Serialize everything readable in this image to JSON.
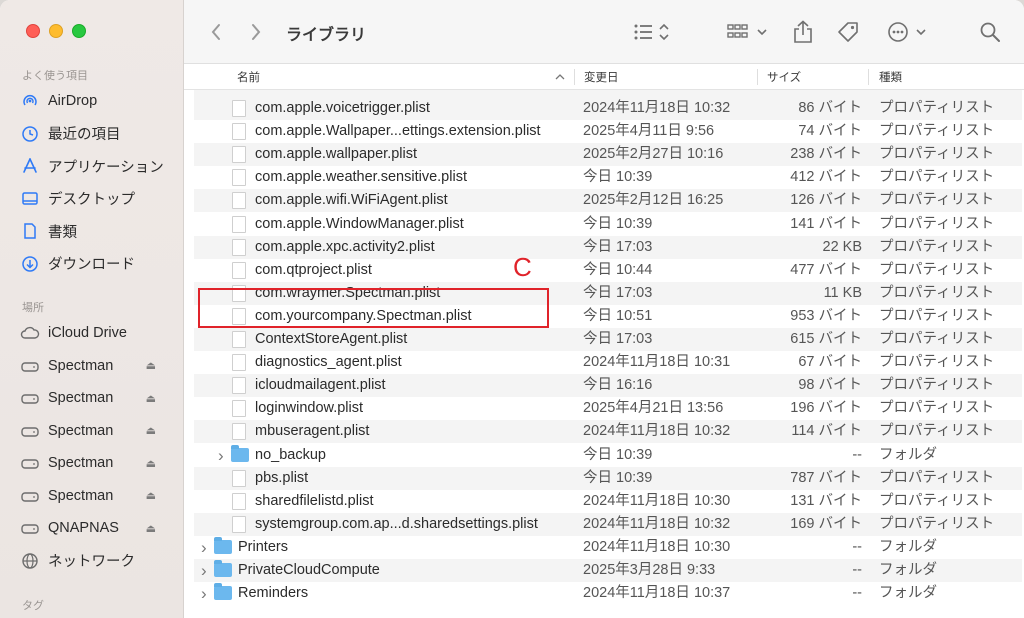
{
  "toolbar": {
    "title": "ライブラリ",
    "back_icon": "chevron-left-icon",
    "forward_icon": "chevron-right-icon"
  },
  "sidebar": {
    "favorites_title": "よく使う項目",
    "locations_title": "場所",
    "tags_title": "タグ",
    "favorites": [
      {
        "label": "AirDrop",
        "icon": "airdrop-icon"
      },
      {
        "label": "最近の項目",
        "icon": "clock-icon"
      },
      {
        "label": "アプリケーション",
        "icon": "applications-icon"
      },
      {
        "label": "デスクトップ",
        "icon": "desktop-icon"
      },
      {
        "label": "書類",
        "icon": "document-icon"
      },
      {
        "label": "ダウンロード",
        "icon": "download-icon"
      }
    ],
    "locations": [
      {
        "label": "iCloud Drive",
        "icon": "cloud-icon",
        "eject": false
      },
      {
        "label": "Spectman",
        "icon": "drive-icon",
        "eject": true
      },
      {
        "label": "Spectman",
        "icon": "drive-icon",
        "eject": true
      },
      {
        "label": "Spectman",
        "icon": "drive-icon",
        "eject": true
      },
      {
        "label": "Spectman",
        "icon": "drive-icon",
        "eject": true
      },
      {
        "label": "Spectman",
        "icon": "drive-icon",
        "eject": true
      },
      {
        "label": "QNAPNAS",
        "icon": "drive-icon",
        "eject": true
      },
      {
        "label": "ネットワーク",
        "icon": "globe-icon",
        "eject": false
      }
    ]
  },
  "header": {
    "name": "名前",
    "date": "変更日",
    "size": "サイズ",
    "kind": "種類"
  },
  "rows": [
    {
      "name": "com.apple.voicetrigger.plist",
      "date": "2024年11月18日 10:32",
      "size": "86 バイト",
      "kind": "プロパティリスト",
      "type": "file",
      "indent": 1
    },
    {
      "name": "com.apple.Wallpaper...ettings.extension.plist",
      "date": "2025年4月11日 9:56",
      "size": "74 バイト",
      "kind": "プロパティリスト",
      "type": "file",
      "indent": 1
    },
    {
      "name": "com.apple.wallpaper.plist",
      "date": "2025年2月27日 10:16",
      "size": "238 バイト",
      "kind": "プロパティリスト",
      "type": "file",
      "indent": 1
    },
    {
      "name": "com.apple.weather.sensitive.plist",
      "date": "今日 10:39",
      "size": "412 バイト",
      "kind": "プロパティリスト",
      "type": "file",
      "indent": 1
    },
    {
      "name": "com.apple.wifi.WiFiAgent.plist",
      "date": "2025年2月12日 16:25",
      "size": "126 バイト",
      "kind": "プロパティリスト",
      "type": "file",
      "indent": 1
    },
    {
      "name": "com.apple.WindowManager.plist",
      "date": "今日 10:39",
      "size": "141 バイト",
      "kind": "プロパティリスト",
      "type": "file",
      "indent": 1
    },
    {
      "name": "com.apple.xpc.activity2.plist",
      "date": "今日 17:03",
      "size": "22 KB",
      "kind": "プロパティリスト",
      "type": "file",
      "indent": 1
    },
    {
      "name": "com.qtproject.plist",
      "date": "今日 10:44",
      "size": "477 バイト",
      "kind": "プロパティリスト",
      "type": "file",
      "indent": 1
    },
    {
      "name": "com.wraymer.Spectman.plist",
      "date": "今日 17:03",
      "size": "11 KB",
      "kind": "プロパティリスト",
      "type": "file",
      "indent": 1
    },
    {
      "name": "com.yourcompany.Spectman.plist",
      "date": "今日 10:51",
      "size": "953 バイト",
      "kind": "プロパティリスト",
      "type": "file",
      "indent": 1
    },
    {
      "name": "ContextStoreAgent.plist",
      "date": "今日 17:03",
      "size": "615 バイト",
      "kind": "プロパティリスト",
      "type": "file",
      "indent": 1
    },
    {
      "name": "diagnostics_agent.plist",
      "date": "2024年11月18日 10:31",
      "size": "67 バイト",
      "kind": "プロパティリスト",
      "type": "file",
      "indent": 1
    },
    {
      "name": "icloudmailagent.plist",
      "date": "今日 16:16",
      "size": "98 バイト",
      "kind": "プロパティリスト",
      "type": "file",
      "indent": 1
    },
    {
      "name": "loginwindow.plist",
      "date": "2025年4月21日 13:56",
      "size": "196 バイト",
      "kind": "プロパティリスト",
      "type": "file",
      "indent": 1
    },
    {
      "name": "mbuseragent.plist",
      "date": "2024年11月18日 10:32",
      "size": "114 バイト",
      "kind": "プロパティリスト",
      "type": "file",
      "indent": 1
    },
    {
      "name": "no_backup",
      "date": "今日 10:39",
      "size": "--",
      "kind": "フォルダ",
      "type": "folder",
      "indent": 1
    },
    {
      "name": "pbs.plist",
      "date": "今日 10:39",
      "size": "787 バイト",
      "kind": "プロパティリスト",
      "type": "file",
      "indent": 1
    },
    {
      "name": "sharedfilelistd.plist",
      "date": "2024年11月18日 10:30",
      "size": "131 バイト",
      "kind": "プロパティリスト",
      "type": "file",
      "indent": 1
    },
    {
      "name": "systemgroup.com.ap...d.sharedsettings.plist",
      "date": "2024年11月18日 10:32",
      "size": "169 バイト",
      "kind": "プロパティリスト",
      "type": "file",
      "indent": 1
    },
    {
      "name": "Printers",
      "date": "2024年11月18日 10:30",
      "size": "--",
      "kind": "フォルダ",
      "type": "folder",
      "indent": 0
    },
    {
      "name": "PrivateCloudCompute",
      "date": "2025年3月28日 9:33",
      "size": "--",
      "kind": "フォルダ",
      "type": "folder",
      "indent": 0
    },
    {
      "name": "Reminders",
      "date": "2024年11月18日 10:37",
      "size": "--",
      "kind": "フォルダ",
      "type": "folder",
      "indent": 0
    }
  ],
  "annotation": {
    "label": "C",
    "color": "#e0232a"
  }
}
